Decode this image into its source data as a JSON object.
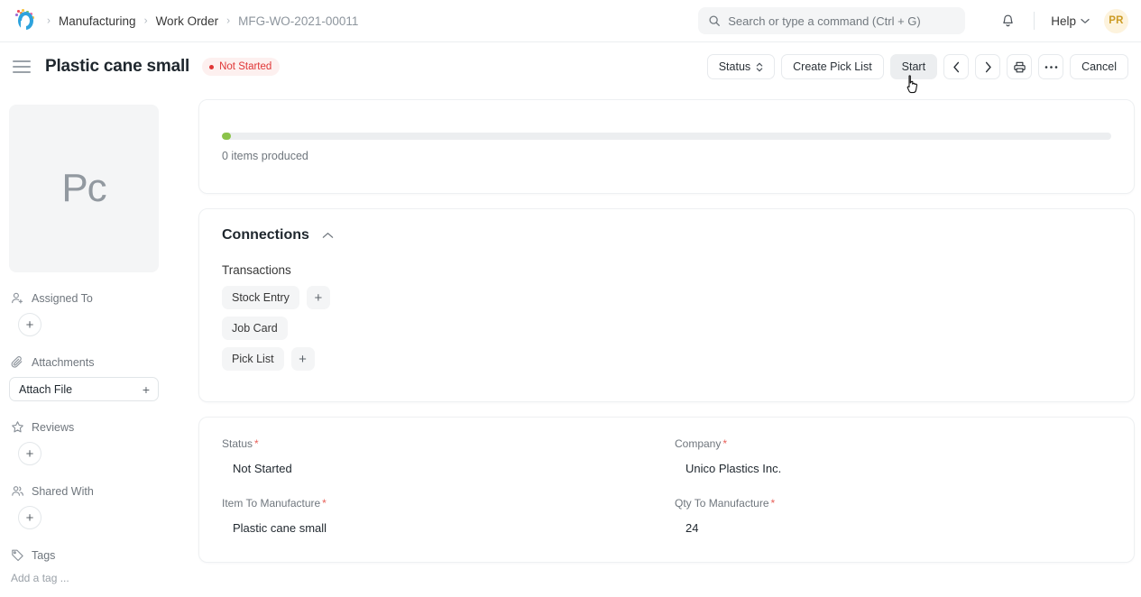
{
  "navbar": {
    "logo_name": "frappe-logo",
    "breadcrumbs": [
      {
        "label": "Manufacturing",
        "current": false
      },
      {
        "label": "Work Order",
        "current": false
      },
      {
        "label": "MFG-WO-2021-00011",
        "current": true
      }
    ],
    "separator": "›",
    "search": {
      "placeholder": "Search or type a command (Ctrl + G)",
      "value": ""
    },
    "notifications_label": "Notifications",
    "help_label": "Help",
    "avatar_initials": "PR"
  },
  "page_head": {
    "menu_label": "Sidebar toggle",
    "title": "Plastic cane small",
    "status_badge": "Not Started",
    "actions": {
      "status_label": "Status",
      "create_pick_list_label": "Create Pick List",
      "start_label": "Start",
      "prev_label": "Previous",
      "next_label": "Next",
      "print_label": "Print",
      "menu_label": "…",
      "cancel_label": "Cancel"
    }
  },
  "sidebar": {
    "thumbnail_initials": "Pc",
    "sections": [
      {
        "icon": "assigned-to-icon",
        "label": "Assigned To",
        "action": "+"
      },
      {
        "icon": "attachment-icon",
        "label": "Attachments",
        "action": "+"
      },
      {
        "icon": "star-icon",
        "label": "Reviews",
        "action": "+"
      },
      {
        "icon": "shared-with-icon",
        "label": "Shared With",
        "action": "+"
      },
      {
        "icon": "tag-icon",
        "label": "Tags",
        "action": ""
      }
    ],
    "attach_file_label": "Attach File",
    "attach_plus": "+",
    "tag_placeholder": "Add a tag ..."
  },
  "progress_card": {
    "percent": 1,
    "fill_color": "#8bc34a",
    "track_color": "#eceef0",
    "caption": "0 items produced"
  },
  "connections": {
    "title": "Connections",
    "collapse_icon": "chevron-up-icon",
    "group_label": "Transactions",
    "links": [
      {
        "label": "Stock Entry",
        "has_add": true,
        "add_label": "+"
      },
      {
        "label": "Job Card",
        "has_add": false,
        "add_label": ""
      },
      {
        "label": "Pick List",
        "has_add": true,
        "add_label": "+"
      }
    ]
  },
  "form": {
    "required_mark": "*",
    "fields": [
      {
        "label": "Status",
        "required": true,
        "value": "Not Started"
      },
      {
        "label": "Company",
        "required": true,
        "value": "Unico Plastics Inc."
      },
      {
        "label": "Item To Manufacture",
        "required": true,
        "value": "Plastic cane small"
      },
      {
        "label": "Qty To Manufacture",
        "required": true,
        "value": "24"
      }
    ]
  },
  "colors": {
    "accent": "#2ea3dd",
    "danger": "#e03636",
    "success": "#8bc34a",
    "avatar_bg": "#fdf3dd",
    "avatar_fg": "#cc9b24"
  }
}
